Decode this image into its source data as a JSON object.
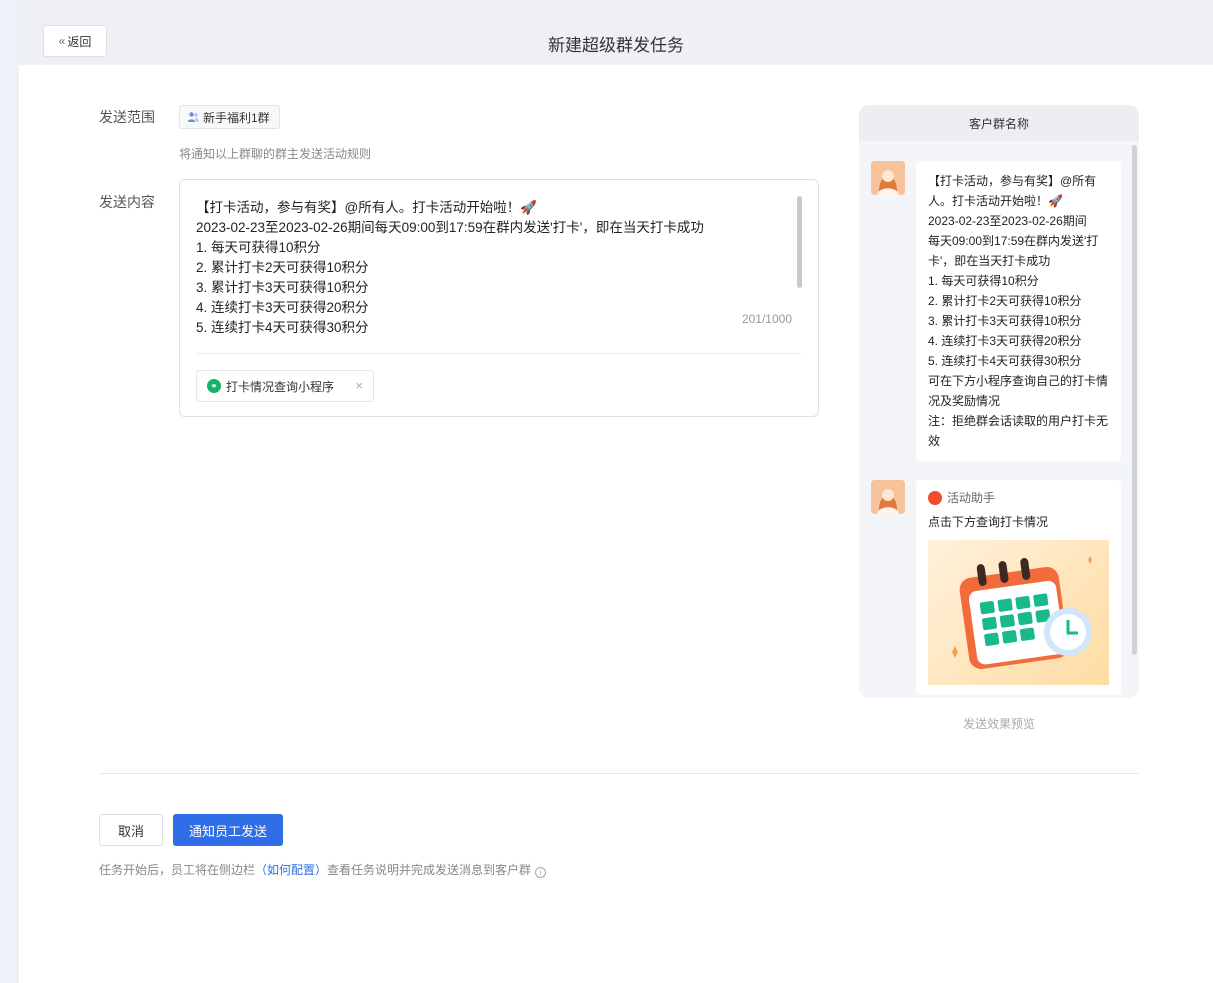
{
  "header": {
    "back_label": "返回",
    "title": "新建超级群发任务"
  },
  "form": {
    "scope_label": "发送范围",
    "scope_tag": "新手福利1群",
    "scope_hint": "将通知以上群聊的群主发送活动规则",
    "content_label": "发送内容",
    "message_lines": [
      "【打卡活动，参与有奖】@所有人。打卡活动开始啦！🚀",
      "2023-02-23至2023-02-26期间每天09:00到17:59在群内发送'打卡'，即在当天打卡成功",
      "1. 每天可获得10积分",
      "2. 累计打卡2天可获得10积分",
      "3. 累计打卡3天可获得10积分",
      "4. 连续打卡3天可获得20积分",
      "5. 连续打卡4天可获得30积分"
    ],
    "counter": "201/1000",
    "attachment_label": "打卡情况查询小程序",
    "attachment_icon": "link-icon"
  },
  "preview": {
    "header": "客户群名称",
    "bubble_lines": [
      "【打卡活动，参与有奖】@所有",
      "人。打卡活动开始啦！🚀",
      "2023-02-23至2023-02-26期间",
      "每天09:00到17:59在群内发送'打",
      "卡'，即在当天打卡成功",
      "1. 每天可获得10积分",
      "2. 累计打卡2天可获得10积分",
      "3. 累计打卡3天可获得10积分",
      "4. 连续打卡3天可获得20积分",
      "5. 连续打卡4天可获得30积分",
      "可在下方小程序查询自己的打卡情",
      "况及奖励情况",
      "注：拒绝群会话读取的用户打卡无",
      "效"
    ],
    "miniprogram_name": "活动助手",
    "miniprogram_desc": "点击下方查询打卡情况",
    "caption": "发送效果预览"
  },
  "actions": {
    "cancel_label": "取消",
    "notify_label": "通知员工发送",
    "note_before": "任务开始后，员工将在侧边栏",
    "note_link": "（如何配置）",
    "note_after": "查看任务说明并完成发送消息到客户群",
    "primary_color": "#2f6ee6"
  }
}
